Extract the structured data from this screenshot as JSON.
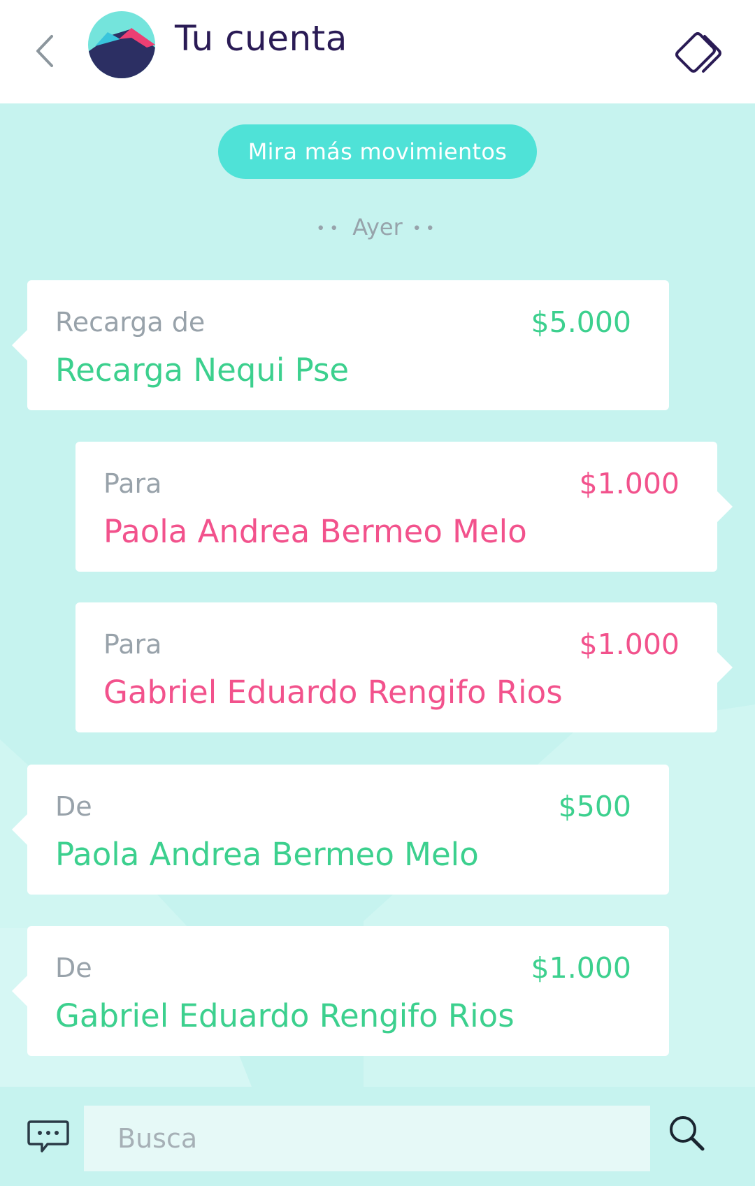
{
  "header": {
    "title": "Tu cuenta",
    "back_icon": "chevron-left-icon",
    "cards_icon": "cards-swap-icon"
  },
  "more_movements_label": "Mira más movimientos",
  "date_separator": {
    "dots_left": "••",
    "label": "Ayer",
    "dots_right": "••"
  },
  "transactions": [
    {
      "direction": "in",
      "label": "Recarga de",
      "name": "Recarga Nequi Pse",
      "amount": "$5.000"
    },
    {
      "direction": "out",
      "label": "Para",
      "name": "Paola Andrea Bermeo Melo",
      "amount": "$1.000"
    },
    {
      "direction": "out",
      "label": "Para",
      "name": "Gabriel Eduardo Rengifo Rios",
      "amount": "$1.000"
    },
    {
      "direction": "in",
      "label": "De",
      "name": "Paola Andrea Bermeo Melo",
      "amount": "$500"
    },
    {
      "direction": "in",
      "label": "De",
      "name": "Gabriel Eduardo Rengifo Rios",
      "amount": "$1.000"
    }
  ],
  "footer": {
    "search_placeholder": "Busca",
    "chat_icon": "chat-bubble-icon",
    "search_icon": "search-icon"
  },
  "colors": {
    "incoming": "#3cd08e",
    "outgoing": "#f2528c",
    "accent": "#4fe2d7",
    "background": "#c6f3ef",
    "title": "#2a1b55"
  }
}
